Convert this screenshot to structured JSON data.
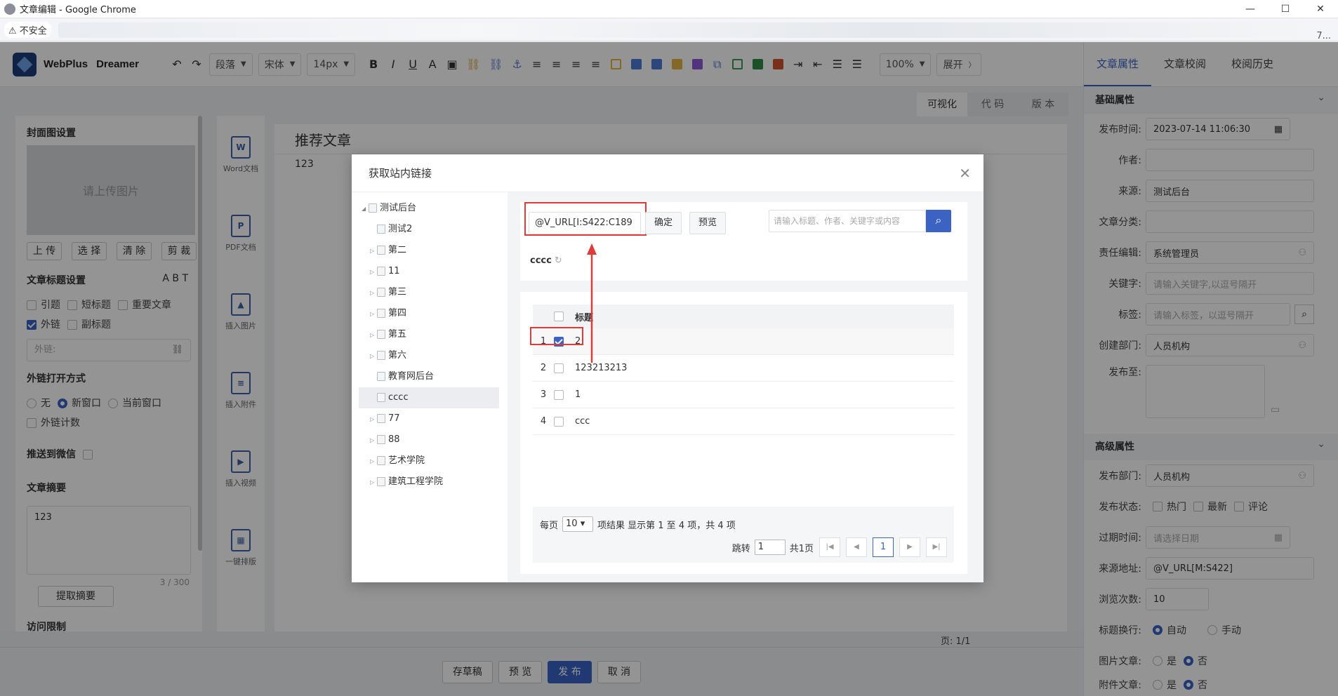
{
  "browser": {
    "window_title": "文章编辑 - Google Chrome",
    "insecure_label": "不安全",
    "address_tail": "7..."
  },
  "brand": {
    "name": "WebPlus",
    "sub": "Dreamer"
  },
  "toolbar": {
    "paragraph": "段落",
    "font": "宋体",
    "size": "14px",
    "zoom": "100%",
    "expand": "展开"
  },
  "right_panel": {
    "tabs": [
      "文章属性",
      "文章校阅",
      "校阅历史"
    ],
    "basic_title": "基础属性",
    "labels": {
      "publish_time": "发布时间:",
      "author": "作者:",
      "source": "来源:",
      "category": "文章分类:",
      "editor": "责任编辑:",
      "keywords": "关键字:",
      "tags": "标签:",
      "dept": "创建部门:",
      "publish_to": "发布至:"
    },
    "values": {
      "publish_time": "2023-07-14 11:06:30",
      "source": "测试后台",
      "editor": "系统管理员",
      "keywords_ph": "请输入关键字,以逗号隔开",
      "tags_ph": "请输入标签，以逗号隔开",
      "dept": "人员机构"
    },
    "advanced_title": "高级属性",
    "adv_labels": {
      "pub_dept": "发布部门:",
      "pub_state": "发布状态:",
      "expire": "过期时间:",
      "src_url": "来源地址:",
      "views": "浏览次数:",
      "title_wrap": "标题换行:",
      "pic_article": "图片文章:",
      "attach_article": "附件文章:"
    },
    "adv_values": {
      "pub_dept": "人员机构",
      "state_hot": "热门",
      "state_new": "最新",
      "state_comment": "评论",
      "expire_ph": "请选择日期",
      "src_url": "@V_URL[M:S422]",
      "views": "10",
      "auto": "自动",
      "manual": "手动",
      "yes": "是",
      "no": "否"
    }
  },
  "left_panel": {
    "cover_title": "封面图设置",
    "cover_placeholder": "请上传图片",
    "cover_btns": [
      "上 传",
      "选 择",
      "清 除",
      "剪 裁"
    ],
    "title_settings": "文章标题设置",
    "opt_quote": "引题",
    "opt_short": "短标题",
    "opt_important": "重要文章",
    "opt_external": "外链",
    "opt_subtitle": "副标题",
    "external_ph": "外链:",
    "open_mode": "外链打开方式",
    "mode_none": "无",
    "mode_new": "新窗口",
    "mode_current": "当前窗口",
    "link_count": "外链计数",
    "push_wechat": "推送到微信",
    "summary_title": "文章摘要",
    "summary_value": "123",
    "summary_count": "3 / 300",
    "extract_btn": "提取摘要",
    "access_limit": "访问限制"
  },
  "side_icons": [
    {
      "label": "Word文档",
      "glyph": "W"
    },
    {
      "label": "PDF文档",
      "glyph": "P"
    },
    {
      "label": "插入图片",
      "glyph": "▲"
    },
    {
      "label": "插入附件",
      "glyph": "≡"
    },
    {
      "label": "插入视频",
      "glyph": "▶"
    },
    {
      "label": "一键排版",
      "glyph": "▦"
    }
  ],
  "editor": {
    "view_tabs": [
      "可视化",
      "代 码",
      "版 本"
    ],
    "title": "推荐文章",
    "body": "123",
    "status_page": "页: 1/1"
  },
  "bottom_buttons": [
    "存草稿",
    "预 览",
    "发 布",
    "取 消"
  ],
  "dialog": {
    "title": "获取站内链接",
    "tree": [
      {
        "label": "测试后台",
        "arrow": "◢",
        "level": 0
      },
      {
        "label": "测试2",
        "arrow": "",
        "level": 1
      },
      {
        "label": "第二",
        "arrow": "▷",
        "level": 1
      },
      {
        "label": "11",
        "arrow": "▷",
        "level": 1
      },
      {
        "label": "第三",
        "arrow": "▷",
        "level": 1
      },
      {
        "label": "第四",
        "arrow": "▷",
        "level": 1
      },
      {
        "label": "第五",
        "arrow": "▷",
        "level": 1
      },
      {
        "label": "第六",
        "arrow": "▷",
        "level": 1
      },
      {
        "label": "教育网后台",
        "arrow": "",
        "level": 1
      },
      {
        "label": "cccc",
        "arrow": "",
        "level": 1,
        "selected": true
      },
      {
        "label": "77",
        "arrow": "▷",
        "level": 1
      },
      {
        "label": "88",
        "arrow": "▷",
        "level": 1
      },
      {
        "label": "艺术学院",
        "arrow": "▷",
        "level": 1
      },
      {
        "label": "建筑工程学院",
        "arrow": "▷",
        "level": 1
      }
    ],
    "url_value": "@V_URL[I:S422:C189",
    "confirm": "确定",
    "preview": "预览",
    "search_ph": "请输入标题、作者、关键字或内容",
    "crumb": "cccc",
    "table_header": "标题",
    "rows": [
      {
        "no": "1",
        "title": "2",
        "checked": true
      },
      {
        "no": "2",
        "title": "123213213",
        "checked": false
      },
      {
        "no": "3",
        "title": "1",
        "checked": false
      },
      {
        "no": "4",
        "title": "ccc",
        "checked": false
      }
    ],
    "pager": {
      "per_page": "每页",
      "size": "10",
      "info": "项结果 显示第 1 至 4 项，共 4 项",
      "jump": "跳转",
      "jump_val": "1",
      "total_pages": "共1页",
      "current": "1"
    }
  }
}
